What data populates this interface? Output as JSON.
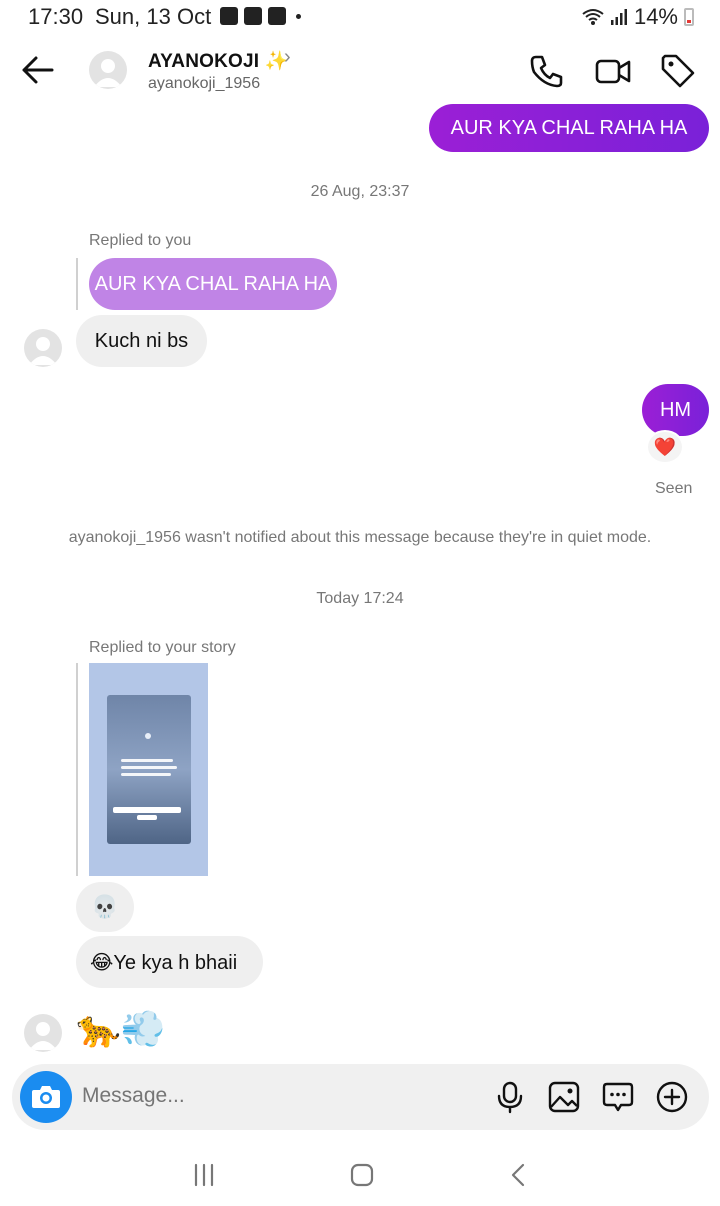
{
  "status_bar": {
    "time": "17:30",
    "date": "Sun, 13 Oct",
    "battery": "14%"
  },
  "header": {
    "name": "AYANOKOJI",
    "name_emoji": "✨",
    "username": "ayanokoji_1956"
  },
  "messages": {
    "top_sent": "AUR KYA CHAL RAHA HA",
    "timestamp_1": "26 Aug, 23:37",
    "reply_label_1": "Replied to you",
    "quoted_message": "AUR KYA CHAL RAHA HA",
    "recv_1": "Kuch ni bs",
    "sent_hm": "HM",
    "reaction": "❤️",
    "seen": "Seen",
    "quiet_mode_note": "ayanokoji_1956 wasn't notified about this message because they're in quiet mode.",
    "timestamp_2": "Today 17:24",
    "reply_label_2": "Replied to your story",
    "recv_skull": "💀",
    "recv_2": "😂Ye kya h bhaii",
    "recv_emojis": "🐆💨"
  },
  "composer": {
    "placeholder": "Message..."
  },
  "colors": {
    "sent_bubble": "#8a1fd8",
    "quoted_bubble": "#c084e6",
    "received_bubble": "#efefef",
    "camera_button": "#1a8cf0"
  },
  "icons": {
    "back": "arrow-left-icon",
    "call": "phone-icon",
    "video": "video-camera-icon",
    "tag": "tag-icon",
    "camera": "camera-icon",
    "mic": "microphone-icon",
    "gallery": "image-icon",
    "sticker": "chat-bubble-icon",
    "add": "plus-circle-icon"
  }
}
